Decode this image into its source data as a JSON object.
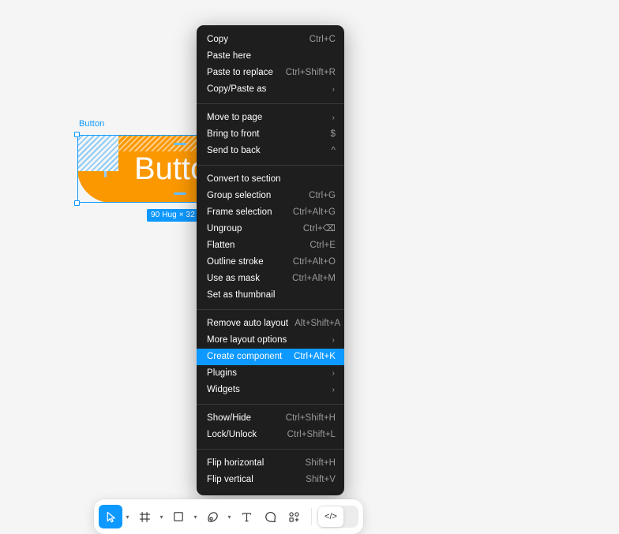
{
  "canvas": {
    "background_color": "#f5f5f5",
    "node_label": "Button",
    "button_text": "Butto",
    "button_fill": "#fb9800",
    "size_badge": "90 Hug × 32 ",
    "accent_color": "#0d99ff"
  },
  "context_menu": {
    "groups": [
      {
        "items": [
          {
            "label": "Copy",
            "shortcut": "Ctrl+C",
            "submenu": false,
            "selected": false
          },
          {
            "label": "Paste here",
            "shortcut": "",
            "submenu": false,
            "selected": false
          },
          {
            "label": "Paste to replace",
            "shortcut": "Ctrl+Shift+R",
            "submenu": false,
            "selected": false
          },
          {
            "label": "Copy/Paste as",
            "shortcut": "",
            "submenu": true,
            "selected": false
          }
        ]
      },
      {
        "items": [
          {
            "label": "Move to page",
            "shortcut": "",
            "submenu": true,
            "selected": false
          },
          {
            "label": "Bring to front",
            "shortcut": "$",
            "submenu": false,
            "selected": false
          },
          {
            "label": "Send to back",
            "shortcut": "^",
            "submenu": false,
            "selected": false
          }
        ]
      },
      {
        "items": [
          {
            "label": "Convert to section",
            "shortcut": "",
            "submenu": false,
            "selected": false
          },
          {
            "label": "Group selection",
            "shortcut": "Ctrl+G",
            "submenu": false,
            "selected": false
          },
          {
            "label": "Frame selection",
            "shortcut": "Ctrl+Alt+G",
            "submenu": false,
            "selected": false
          },
          {
            "label": "Ungroup",
            "shortcut": "Ctrl+⌫",
            "submenu": false,
            "selected": false
          },
          {
            "label": "Flatten",
            "shortcut": "Ctrl+E",
            "submenu": false,
            "selected": false
          },
          {
            "label": "Outline stroke",
            "shortcut": "Ctrl+Alt+O",
            "submenu": false,
            "selected": false
          },
          {
            "label": "Use as mask",
            "shortcut": "Ctrl+Alt+M",
            "submenu": false,
            "selected": false
          },
          {
            "label": "Set as thumbnail",
            "shortcut": "",
            "submenu": false,
            "selected": false
          }
        ]
      },
      {
        "items": [
          {
            "label": "Remove auto layout",
            "shortcut": "Alt+Shift+A",
            "submenu": false,
            "selected": false
          },
          {
            "label": "More layout options",
            "shortcut": "",
            "submenu": true,
            "selected": false
          },
          {
            "label": "Create component",
            "shortcut": "Ctrl+Alt+K",
            "submenu": false,
            "selected": true
          },
          {
            "label": "Plugins",
            "shortcut": "",
            "submenu": true,
            "selected": false
          },
          {
            "label": "Widgets",
            "shortcut": "",
            "submenu": true,
            "selected": false
          }
        ]
      },
      {
        "items": [
          {
            "label": "Show/Hide",
            "shortcut": "Ctrl+Shift+H",
            "submenu": false,
            "selected": false
          },
          {
            "label": "Lock/Unlock",
            "shortcut": "Ctrl+Shift+L",
            "submenu": false,
            "selected": false
          }
        ]
      },
      {
        "items": [
          {
            "label": "Flip horizontal",
            "shortcut": "Shift+H",
            "submenu": false,
            "selected": false
          },
          {
            "label": "Flip vertical",
            "shortcut": "Shift+V",
            "submenu": false,
            "selected": false
          }
        ]
      }
    ],
    "submenu_arrow": "›",
    "highlight_color": "#0d99ff",
    "background_color": "#1e1e1e"
  },
  "toolbar": {
    "tools": [
      {
        "name": "move-tool",
        "icon": "cursor-icon",
        "active": true,
        "caret": true
      },
      {
        "name": "frame-tool",
        "icon": "frame-icon",
        "active": false,
        "caret": true
      },
      {
        "name": "shape-tool",
        "icon": "rectangle-icon",
        "active": false,
        "caret": true
      },
      {
        "name": "pen-tool",
        "icon": "pen-icon",
        "active": false,
        "caret": true
      },
      {
        "name": "text-tool",
        "icon": "text-icon",
        "active": false,
        "caret": false
      },
      {
        "name": "comment-tool",
        "icon": "comment-icon",
        "active": false,
        "caret": false
      },
      {
        "name": "actions-tool",
        "icon": "actions-icon",
        "active": false,
        "caret": false
      }
    ],
    "dev_mode_label": "</>",
    "caret_glyph": "▾"
  }
}
